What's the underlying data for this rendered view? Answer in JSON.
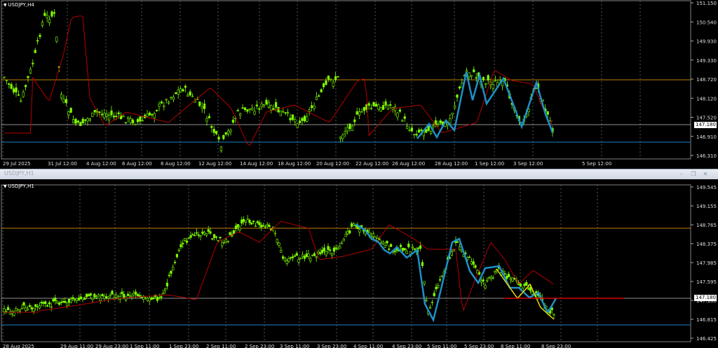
{
  "top": {
    "symbol": "USDJPY,H4",
    "price_labels": [
      "151.150",
      "150.540",
      "149.930",
      "149.330",
      "148.720",
      "148.120",
      "147.520",
      "146.910",
      "146.310"
    ],
    "current_price": "147.180",
    "time_labels": [
      "29 Jul 2025",
      "31 Jul 12:00",
      "4 Aug 12:00",
      "6 Aug 12:00",
      "8 Aug 12:00",
      "12 Aug 12:00",
      "14 Aug 12:00",
      "18 Aug 12:00",
      "20 Aug 12:00",
      "22 Aug 12:00",
      "26 Aug 12:00",
      "28 Aug 12:00",
      "1 Sep 12:00",
      "3 Sep 12:00",
      "5 Sep 12:00"
    ]
  },
  "window": {
    "title": "USDJPY,H1"
  },
  "bottom": {
    "symbol": "USDJPY,H1",
    "price_labels": [
      "149.545",
      "149.155",
      "148.765",
      "148.375",
      "147.985",
      "147.595",
      "147.180",
      "146.815",
      "146.425"
    ],
    "current_price": "147.180",
    "time_labels": [
      "28 Aug 2025",
      "29 Aug 11:00",
      "29 Aug 23:00",
      "1 Sep 11:00",
      "1 Sep 23:00",
      "2 Sep 11:00",
      "2 Sep 23:00",
      "3 Sep 11:00",
      "3 Sep 23:00",
      "4 Sep 11:00",
      "4 Sep 23:00",
      "5 Sep 11:00",
      "5 Sep 23:00",
      "8 Sep 11:00",
      "8 Sep 23:00"
    ]
  },
  "colors": {
    "background": "#000000",
    "candle": "#7fff00",
    "ma": "#b40000",
    "zigzag": "#1e90c8",
    "zigzag_yellow": "#e6dc00",
    "resistance": "#c08000",
    "support": "#1e7fc0",
    "current": "#c0c0c0",
    "hline_red": "#e00000"
  }
}
